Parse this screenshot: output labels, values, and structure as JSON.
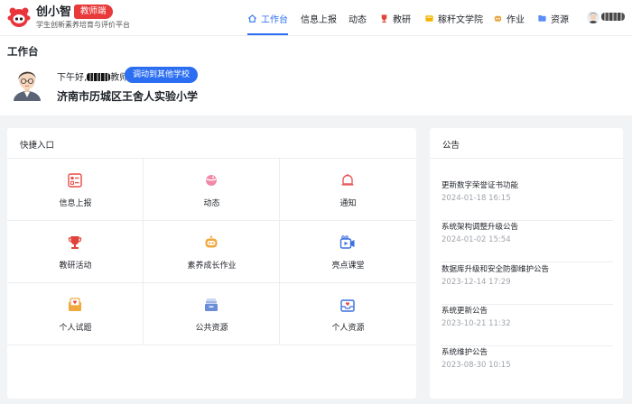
{
  "brand": {
    "name": "创小智",
    "badge": "教师端",
    "subtitle": "学生创新素养培育与评价平台"
  },
  "nav": [
    {
      "label": "工作台",
      "icon": "home-icon",
      "active": true
    },
    {
      "label": "信息上报",
      "icon": ""
    },
    {
      "label": "动态",
      "icon": ""
    },
    {
      "label": "教研",
      "icon": "trophy-icon"
    },
    {
      "label": "稼秆文学院",
      "icon": "book-icon"
    },
    {
      "label": "作业",
      "icon": "robot-icon"
    },
    {
      "label": "资源",
      "icon": "folder-icon"
    }
  ],
  "workbench": {
    "title": "工作台",
    "greeting": "下午好,",
    "greeting_suffix": "教师",
    "switch_button": "调动到其他学校",
    "school": "济南市历城区王舍人实验小学"
  },
  "quick_entry": {
    "title": "快捷入口",
    "items": [
      {
        "label": "信息上报",
        "icon": "report-icon"
      },
      {
        "label": "动态",
        "icon": "planet-icon"
      },
      {
        "label": "通知",
        "icon": "bell-icon"
      },
      {
        "label": "教研活动",
        "icon": "trophy-icon"
      },
      {
        "label": "素养成长作业",
        "icon": "robot-icon"
      },
      {
        "label": "亮点课堂",
        "icon": "video-icon"
      },
      {
        "label": "个人试题",
        "icon": "mail-heart-icon"
      },
      {
        "label": "公共资源",
        "icon": "archive-icon"
      },
      {
        "label": "个人资源",
        "icon": "inbox-heart-icon"
      }
    ]
  },
  "notices": {
    "title": "公告",
    "items": [
      {
        "title": "更新数字荣誉证书功能",
        "date": "2024-01-18 16:15"
      },
      {
        "title": "系统架构调整升级公告",
        "date": "2024-01-02 15:54"
      },
      {
        "title": "数据库升级和安全防御维护公告",
        "date": "2023-12-14 17:29"
      },
      {
        "title": "系统更新公告",
        "date": "2023-10-21 11:32"
      },
      {
        "title": "系统维护公告",
        "date": "2023-08-30 10:15"
      }
    ]
  }
}
